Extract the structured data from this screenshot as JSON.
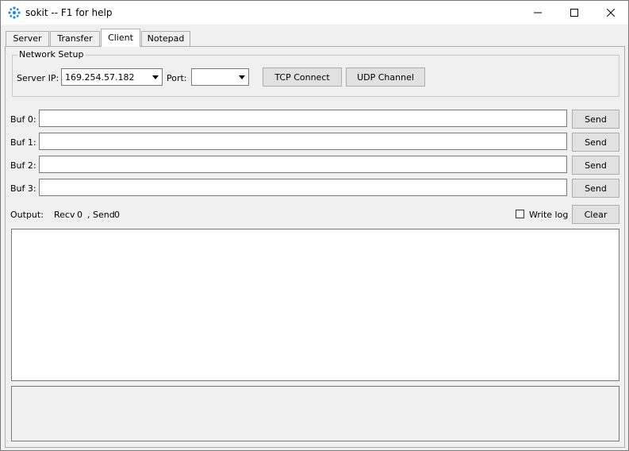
{
  "window": {
    "title": "sokit -- F1 for help",
    "app_icon": "snowflake-gear-icon",
    "controls": [
      "minimize-icon",
      "maximize-icon",
      "close-icon"
    ]
  },
  "tabs": [
    {
      "label": "Server",
      "active": false
    },
    {
      "label": "Transfer",
      "active": false
    },
    {
      "label": "Client",
      "active": true
    },
    {
      "label": "Notepad",
      "active": false
    }
  ],
  "network_setup": {
    "title": "Network Setup",
    "server_ip_label": "Server IP:",
    "server_ip_value": "169.254.57.182",
    "port_label": "Port:",
    "port_value": "",
    "tcp_connect_label": "TCP Connect",
    "udp_channel_label": "UDP Channel"
  },
  "buffers": [
    {
      "label": "Buf 0:",
      "value": "",
      "send_label": "Send"
    },
    {
      "label": "Buf 1:",
      "value": "",
      "send_label": "Send"
    },
    {
      "label": "Buf 2:",
      "value": "",
      "send_label": "Send"
    },
    {
      "label": "Buf 3:",
      "value": "",
      "send_label": "Send"
    }
  ],
  "output": {
    "label": "Output:",
    "recv_label": "Recv",
    "recv_count": "0",
    "send_separator": ", Send",
    "send_count": "0",
    "write_log_label": "Write log",
    "write_log_checked": false,
    "clear_label": "Clear",
    "log_text": ""
  },
  "colors": {
    "window_bg": "#f0f0f0",
    "button_bg": "#e1e1e1",
    "border": "#7a7a7a"
  }
}
